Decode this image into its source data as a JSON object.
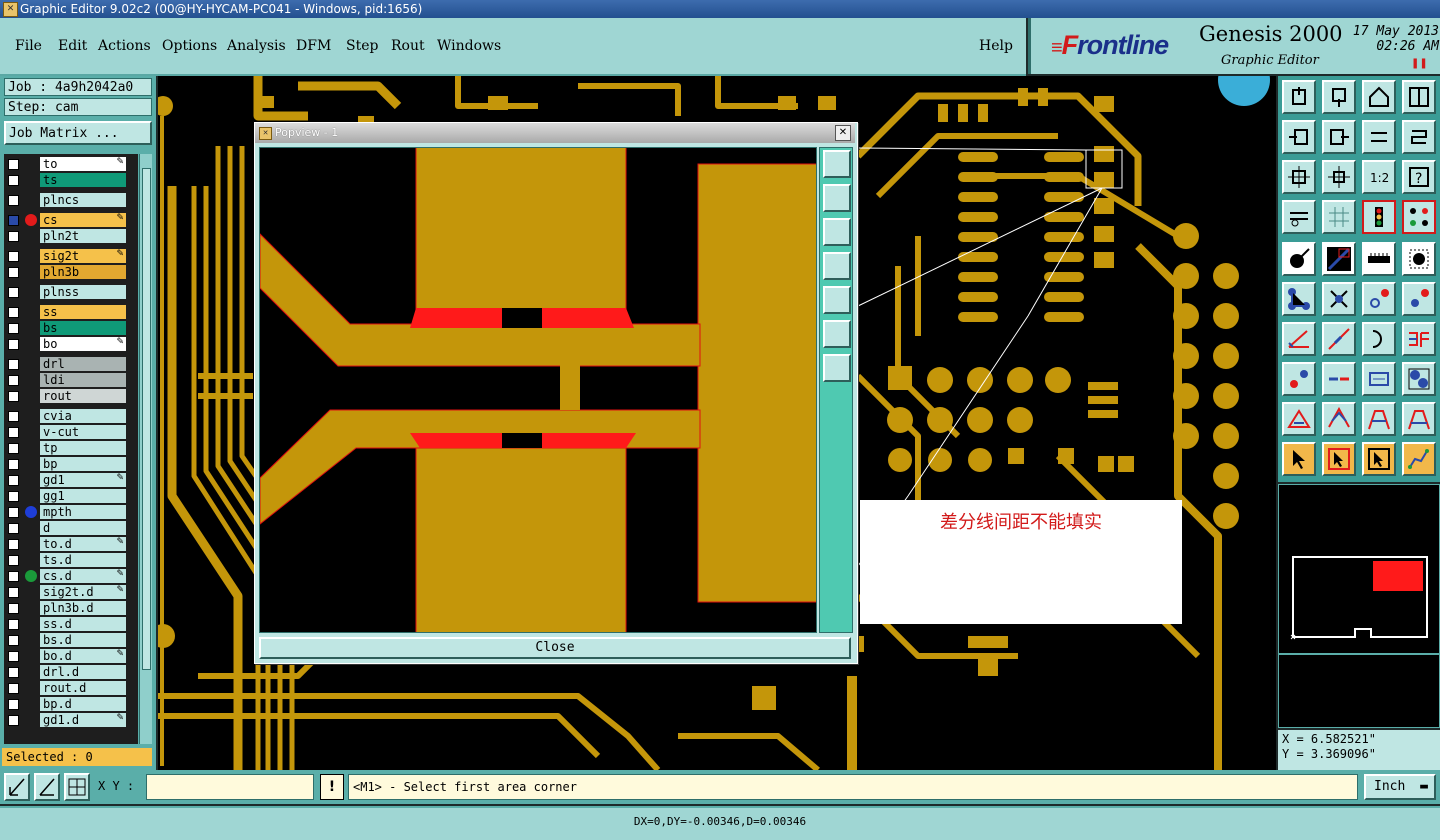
{
  "window": {
    "title": "Graphic Editor 9.02c2 (00@HY-HYCAM-PC041 - Windows, pid:1656)"
  },
  "menu": [
    "File",
    "Edit",
    "Actions",
    "Options",
    "Analysis",
    "DFM",
    "Step",
    "Rout",
    "Windows"
  ],
  "help": "Help",
  "brand": {
    "logo_mark": "F",
    "logo_rest": "rontline",
    "product": "Genesis 2000",
    "subtitle": "Graphic Editor",
    "date": "17 May 2013",
    "time": "02:26 AM"
  },
  "job": {
    "job_label": "Job : 4a9h2042a0",
    "step_label": "Step: cam",
    "matrix_button": "Job Matrix ..."
  },
  "layers": [
    {
      "name": "to",
      "bg": "#ffffff",
      "pen": true
    },
    {
      "name": "ts",
      "bg": "#0f9a78"
    },
    {
      "name": "plncs",
      "bg": "#bfe6e3"
    },
    {
      "name": "cs",
      "bg": "#f5c14a",
      "pen": true,
      "dot": "#e21b1b",
      "checked": true
    },
    {
      "name": "pln2t",
      "bg": "#bfe6e3"
    },
    {
      "name": "sig2t",
      "bg": "#f5c14a",
      "pen": true
    },
    {
      "name": "pln3b",
      "bg": "#e2a830"
    },
    {
      "name": "plnss",
      "bg": "#bfe6e3"
    },
    {
      "name": "ss",
      "bg": "#f5c14a"
    },
    {
      "name": "bs",
      "bg": "#0f9a78"
    },
    {
      "name": "bo",
      "bg": "#ffffff",
      "pen": true
    },
    {
      "name": "drl",
      "bg": "#a9b3b2"
    },
    {
      "name": "ldi",
      "bg": "#a9b3b2"
    },
    {
      "name": "rout",
      "bg": "#cfd6d5"
    },
    {
      "name": "cvia",
      "bg": "#bfe6e3"
    },
    {
      "name": "v-cut",
      "bg": "#bfe6e3"
    },
    {
      "name": "tp",
      "bg": "#bfe6e3"
    },
    {
      "name": "bp",
      "bg": "#bfe6e3"
    },
    {
      "name": "gd1",
      "bg": "#bfe6e3",
      "pen": true
    },
    {
      "name": "gg1",
      "bg": "#bfe6e3"
    },
    {
      "name": "mpth",
      "bg": "#bfe6e3",
      "dot": "#1e3ed8"
    },
    {
      "name": "d",
      "bg": "#bfe6e3"
    },
    {
      "name": "to.d",
      "bg": "#bfe6e3",
      "pen": true
    },
    {
      "name": "ts.d",
      "bg": "#bfe6e3"
    },
    {
      "name": "cs.d",
      "bg": "#bfe6e3",
      "pen": true,
      "dot": "#1a9a3a"
    },
    {
      "name": "sig2t.d",
      "bg": "#bfe6e3",
      "pen": true
    },
    {
      "name": "pln3b.d",
      "bg": "#bfe6e3"
    },
    {
      "name": "ss.d",
      "bg": "#bfe6e3"
    },
    {
      "name": "bs.d",
      "bg": "#bfe6e3"
    },
    {
      "name": "bo.d",
      "bg": "#bfe6e3",
      "pen": true
    },
    {
      "name": "drl.d",
      "bg": "#bfe6e3"
    },
    {
      "name": "rout.d",
      "bg": "#bfe6e3"
    },
    {
      "name": "bp.d",
      "bg": "#bfe6e3"
    },
    {
      "name": "gd1.d",
      "bg": "#bfe6e3",
      "pen": true
    }
  ],
  "selected": "Selected : 0",
  "popview": {
    "title": "Popview - 1",
    "close_label": "Close"
  },
  "annotation": "差分线间距不能填实",
  "coords": {
    "x": "X = 6.582521\"",
    "y": "Y = 3.369096\""
  },
  "command": {
    "xy_label": "X Y :",
    "xy_value": "",
    "bang": "!",
    "prompt": "<M1> - Select first area corner",
    "unit": "Inch"
  },
  "status": "DX=0,DY=-0.00346,D=0.00346",
  "colors": {
    "copper": "#c4960a",
    "highlight": "#ff1a1a",
    "panel": "#5aaea9",
    "menu": "#9fd6d3"
  }
}
